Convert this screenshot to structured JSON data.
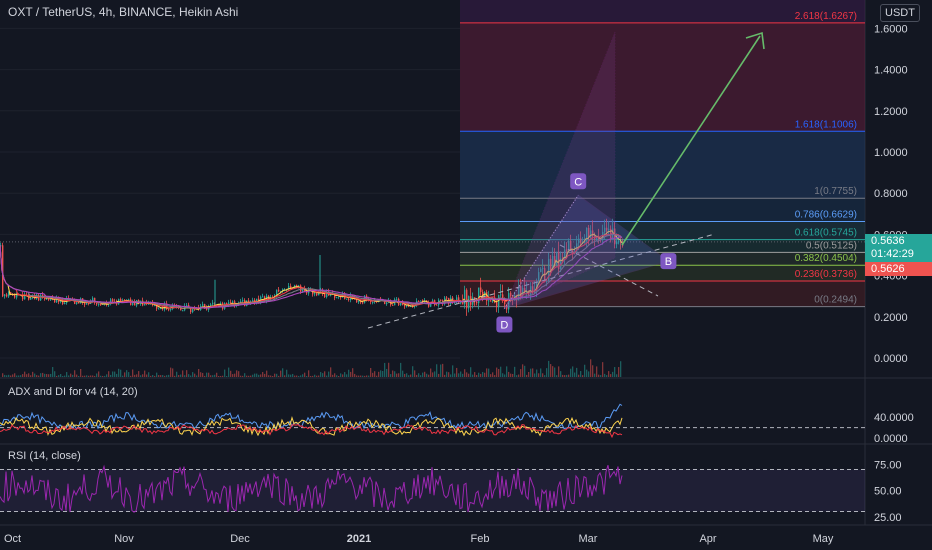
{
  "header": {
    "symbol_title": "OXT / TetherUS, 4h, BINANCE, Heikin Ashi",
    "currency_button": "USDT"
  },
  "price_axis": {
    "ticks": [
      "1.6000",
      "1.4000",
      "1.2000",
      "1.0000",
      "0.8000",
      "0.6000",
      "0.4000",
      "0.2000",
      "0.0000"
    ]
  },
  "price_tags": {
    "last_price": "0.5636",
    "countdown": "01:42:29",
    "low_price": "0.5626",
    "last_color": "#26a69a",
    "low_color": "#ef5350"
  },
  "fib_levels": [
    {
      "label": "2.618(1.6267)",
      "value": 1.6267,
      "color": "#f23645"
    },
    {
      "label": "1.618(1.1006)",
      "value": 1.1006,
      "color": "#2962ff"
    },
    {
      "label": "1(0.7755)",
      "value": 0.7755,
      "color": "#787b86"
    },
    {
      "label": "0.786(0.6629)",
      "value": 0.6629,
      "color": "#5b9cf6"
    },
    {
      "label": "0.618(0.5745)",
      "value": 0.5745,
      "color": "#26a69a"
    },
    {
      "label": "0.5(0.5125)",
      "value": 0.5125,
      "color": "#9e9e9e"
    },
    {
      "label": "0.382(0.4504)",
      "value": 0.4504,
      "color": "#8bc34a"
    },
    {
      "label": "0.236(0.3736)",
      "value": 0.3736,
      "color": "#f23645"
    },
    {
      "label": "0(0.2494)",
      "value": 0.2494,
      "color": "#787b86"
    }
  ],
  "pattern_points": [
    {
      "label": "C",
      "price": 0.79,
      "date": "2021-02-13"
    },
    {
      "label": "D",
      "price": 0.24,
      "date": "2021-01-26"
    },
    {
      "label": "B",
      "price": 0.47,
      "date": "2021-03-07"
    }
  ],
  "adx_pane": {
    "title": "ADX and DI for v4 (14, 20)",
    "ticks": [
      "40.0000",
      "0.0000"
    ],
    "threshold": 20
  },
  "rsi_pane": {
    "title": "RSI (14, close)",
    "ticks": [
      "75.00",
      "50.00",
      "25.00"
    ],
    "upper": 70,
    "lower": 30
  },
  "time_axis": {
    "labels": [
      "Oct",
      "Nov",
      "Dec",
      "2021",
      "Feb",
      "Mar",
      "Apr",
      "May"
    ]
  },
  "colors": {
    "background": "#131722",
    "adx_line": "#5b9cf6",
    "di_plus": "#ffd54f",
    "di_minus": "#f23645",
    "rsi_line": "#9c27b0",
    "target_arrow": "#66bb6a"
  },
  "chart_data": {
    "type": "line",
    "title": "OXT / TetherUS, 4h, BINANCE, Heikin Ashi",
    "x_range": [
      "2020-09-24",
      "2021-05-10"
    ],
    "ylim": [
      0.0,
      1.68
    ],
    "series": [
      {
        "name": "OXT / TetherUS",
        "x": [
          "2020-09-25",
          "2020-10-10",
          "2020-10-25",
          "2020-11-10",
          "2020-11-25",
          "2020-12-05",
          "2020-12-20",
          "2021-01-05",
          "2021-01-20",
          "2021-01-28",
          "2021-02-05",
          "2021-02-13",
          "2021-02-20",
          "2021-02-28",
          "2021-03-05",
          "2021-03-10"
        ],
        "y": [
          0.31,
          0.28,
          0.27,
          0.24,
          0.27,
          0.34,
          0.29,
          0.26,
          0.3,
          0.28,
          0.42,
          0.58,
          0.62,
          0.48,
          0.46,
          0.56
        ]
      }
    ]
  }
}
